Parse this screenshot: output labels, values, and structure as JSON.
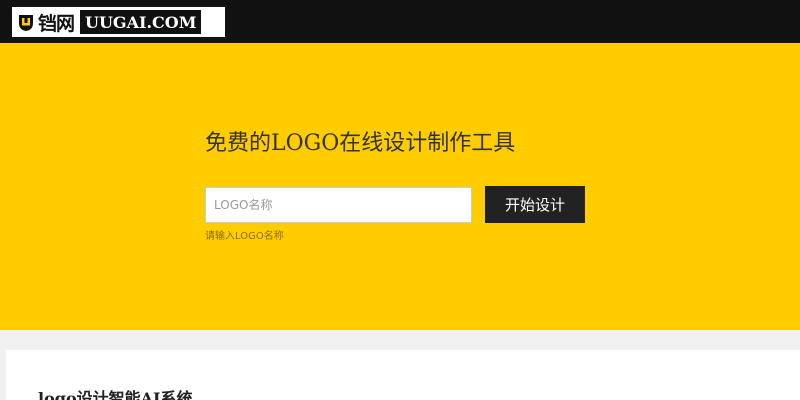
{
  "header": {
    "logo_cn": "铛网",
    "logo_en": "UUGAI.COM"
  },
  "hero": {
    "title": "免费的LOGO在线设计制作工具",
    "input_placeholder": "LOGO名称",
    "input_value": "",
    "start_button_label": "开始设计",
    "hint": "请输入LOGO名称"
  },
  "section": {
    "title": "logo设计智能AI系统"
  },
  "colors": {
    "accent": "#ffcc00",
    "header_bg": "#111111",
    "button_bg": "#222222"
  }
}
